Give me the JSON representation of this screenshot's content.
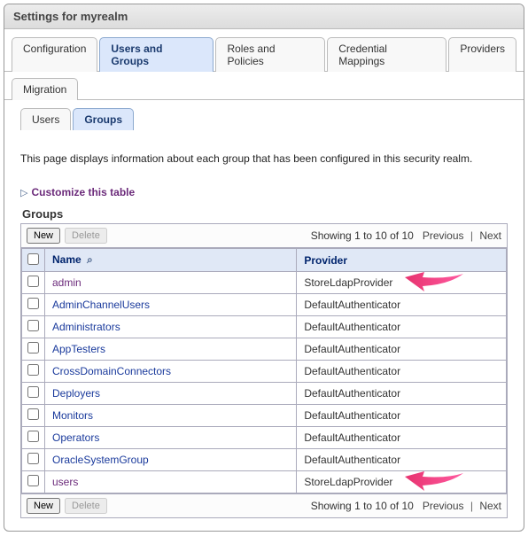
{
  "header": {
    "title": "Settings for myrealm"
  },
  "tabs_primary": [
    {
      "label": "Configuration",
      "selected": false
    },
    {
      "label": "Users and Groups",
      "selected": true
    },
    {
      "label": "Roles and Policies",
      "selected": false
    },
    {
      "label": "Credential Mappings",
      "selected": false
    },
    {
      "label": "Providers",
      "selected": false
    }
  ],
  "tabs_secondary": [
    {
      "label": "Migration",
      "selected": false
    }
  ],
  "tabs_tertiary": [
    {
      "label": "Users",
      "selected": false
    },
    {
      "label": "Groups",
      "selected": true
    }
  ],
  "description": "This page displays information about each group that has been configured in this security realm.",
  "customize_label": "Customize this table",
  "table_title": "Groups",
  "toolbar": {
    "new_label": "New",
    "delete_label": "Delete",
    "showing": "Showing 1 to 10 of 10",
    "prev": "Previous",
    "next": "Next"
  },
  "columns": {
    "name": "Name",
    "provider": "Provider"
  },
  "rows": [
    {
      "name": "admin",
      "provider": "StoreLdapProvider",
      "visited": true,
      "arrow": true
    },
    {
      "name": "AdminChannelUsers",
      "provider": "DefaultAuthenticator"
    },
    {
      "name": "Administrators",
      "provider": "DefaultAuthenticator"
    },
    {
      "name": "AppTesters",
      "provider": "DefaultAuthenticator"
    },
    {
      "name": "CrossDomainConnectors",
      "provider": "DefaultAuthenticator"
    },
    {
      "name": "Deployers",
      "provider": "DefaultAuthenticator"
    },
    {
      "name": "Monitors",
      "provider": "DefaultAuthenticator"
    },
    {
      "name": "Operators",
      "provider": "DefaultAuthenticator"
    },
    {
      "name": "OracleSystemGroup",
      "provider": "DefaultAuthenticator"
    },
    {
      "name": "users",
      "provider": "StoreLdapProvider",
      "visited": true,
      "arrow": true
    }
  ]
}
